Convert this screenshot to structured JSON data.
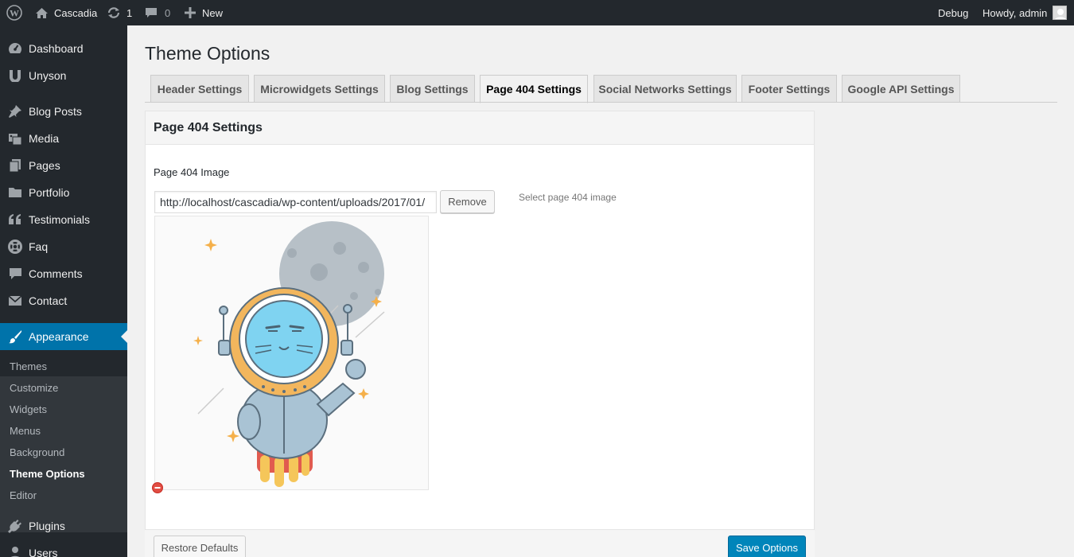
{
  "adminbar": {
    "site_name": "Cascadia",
    "updates_count": "1",
    "comments_count": "0",
    "new_label": "New",
    "debug_label": "Debug",
    "howdy_label": "Howdy, admin"
  },
  "sidebar": {
    "items": [
      {
        "label": "Dashboard",
        "icon": "dashboard-icon"
      },
      {
        "label": "Unyson",
        "icon": "unyson-icon"
      },
      {
        "label": "Blog Posts",
        "icon": "pin-icon"
      },
      {
        "label": "Media",
        "icon": "media-icon"
      },
      {
        "label": "Pages",
        "icon": "pages-icon"
      },
      {
        "label": "Portfolio",
        "icon": "folder-icon"
      },
      {
        "label": "Testimonials",
        "icon": "quote-icon"
      },
      {
        "label": "Faq",
        "icon": "lifebuoy-icon"
      },
      {
        "label": "Comments",
        "icon": "comment-icon"
      },
      {
        "label": "Contact",
        "icon": "envelope-icon"
      },
      {
        "label": "Appearance",
        "icon": "brush-icon"
      },
      {
        "label": "Plugins",
        "icon": "plug-icon"
      },
      {
        "label": "Users",
        "icon": "user-icon"
      }
    ],
    "submenu": [
      "Themes",
      "Customize",
      "Widgets",
      "Menus",
      "Background",
      "Theme Options",
      "Editor"
    ],
    "active_submenu": "Theme Options"
  },
  "page": {
    "title": "Theme Options",
    "tabs": [
      "Header Settings",
      "Microwidgets Settings",
      "Blog Settings",
      "Page 404 Settings",
      "Social Networks Settings",
      "Footer Settings",
      "Google API Settings"
    ],
    "active_tab": "Page 404 Settings"
  },
  "box": {
    "title": "Page 404 Settings",
    "field_label": "Page 404 Image",
    "url_value": "http://localhost/cascadia/wp-content/uploads/2017/01/",
    "remove_label": "Remove",
    "help_text": "Select page 404 image"
  },
  "footer": {
    "restore_label": "Restore Defaults",
    "save_label": "Save Options"
  },
  "colors": {
    "adminbar_bg": "#23282d",
    "accent": "#0073aa",
    "primary_button": "#0085ba"
  }
}
